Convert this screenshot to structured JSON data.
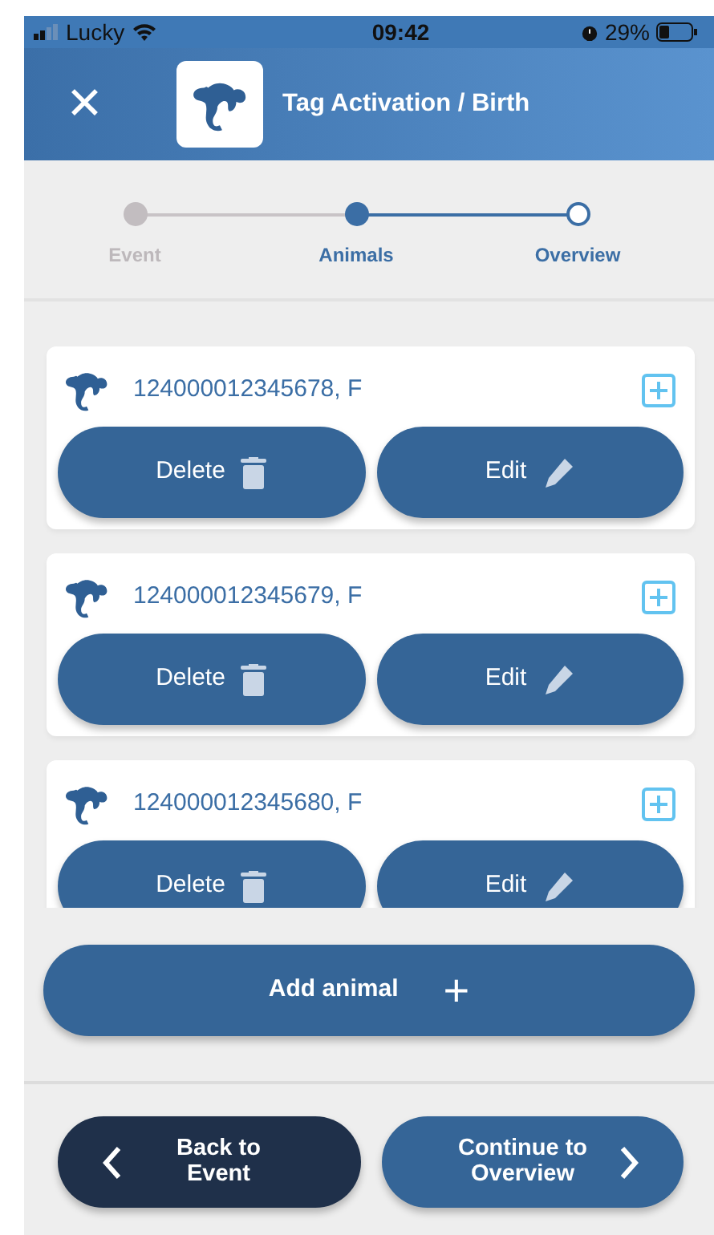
{
  "status_bar": {
    "carrier": "Lucky",
    "time": "09:42",
    "battery": "29%"
  },
  "header": {
    "close": "✕",
    "title": "Tag Activation / Birth"
  },
  "steps": [
    {
      "label": "Event",
      "completed": true,
      "selected": false
    },
    {
      "label": "Animals",
      "completed": false,
      "selected": true
    },
    {
      "label": "Overview",
      "completed": false,
      "selected": false
    }
  ],
  "animals": [
    {
      "id": "124000012345678, F",
      "delete": "Delete",
      "edit": "Edit"
    },
    {
      "id": "124000012345679, F",
      "delete": "Delete",
      "edit": "Edit"
    },
    {
      "id": "124000012345680, F",
      "delete": "Delete",
      "edit": "Edit"
    }
  ],
  "add_button": {
    "label": "Add animal",
    "icon": "+"
  },
  "footer": {
    "back": "Back to Event",
    "continue": "Continue to Overview"
  }
}
